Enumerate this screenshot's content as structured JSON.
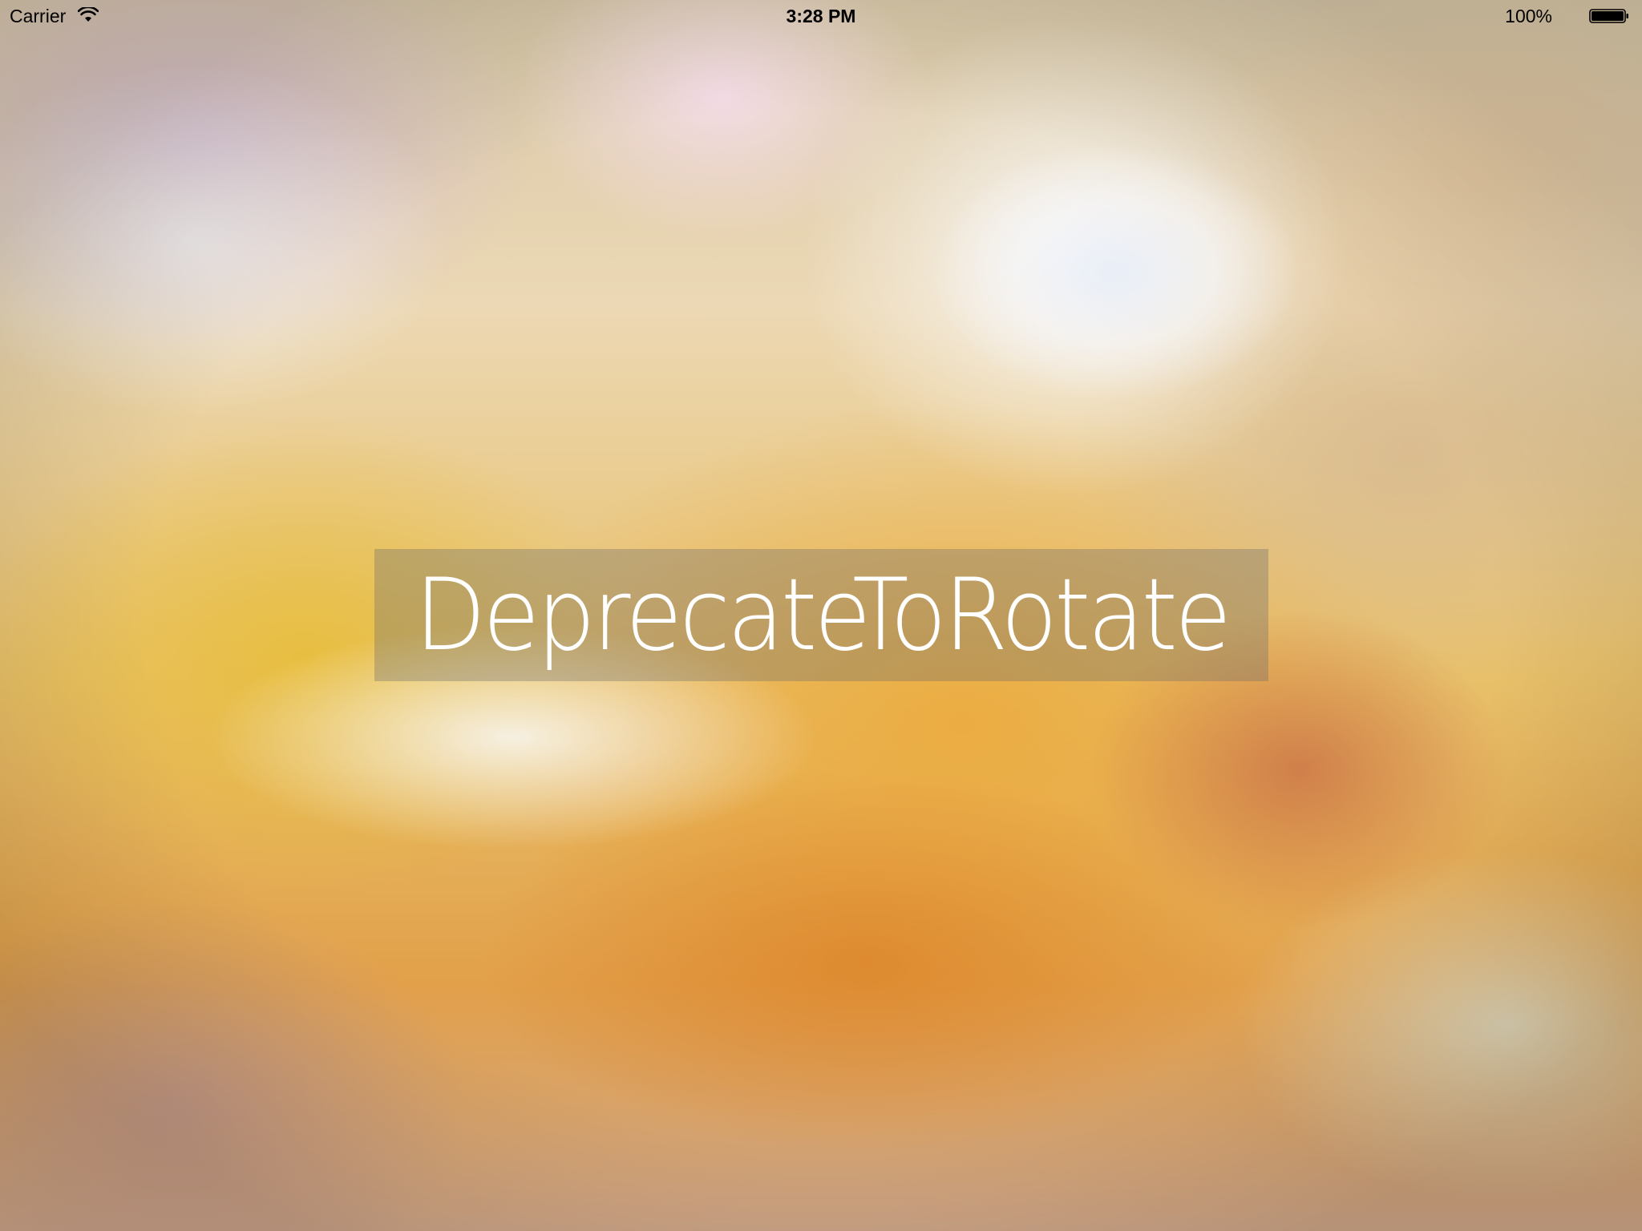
{
  "status_bar": {
    "carrier": "Carrier",
    "time": "3:28 PM",
    "battery_percent": "100%",
    "wifi_icon": "wifi-icon",
    "battery_icon": "battery-icon",
    "battery_level": 1.0
  },
  "main": {
    "title": "DeprecateToRotate"
  }
}
